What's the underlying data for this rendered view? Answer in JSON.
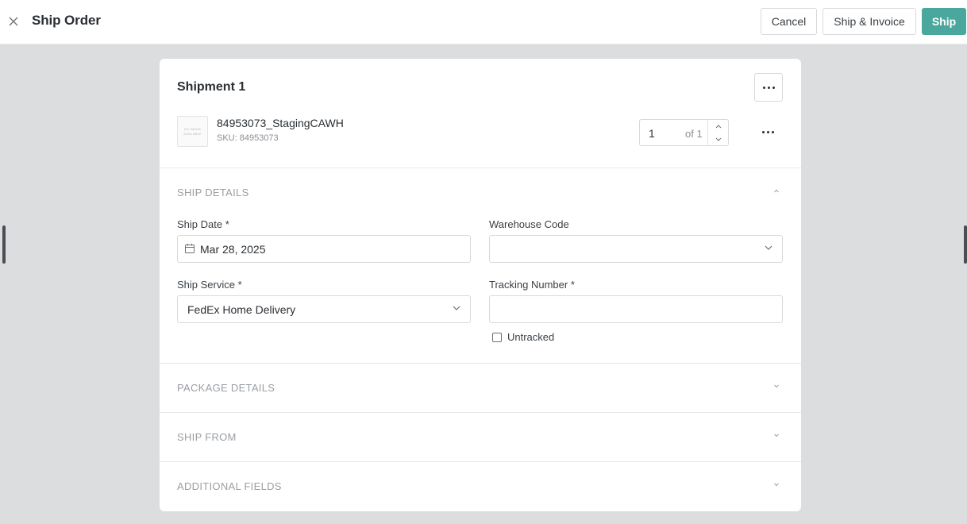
{
  "header": {
    "title": "Ship Order",
    "cancel_label": "Cancel",
    "ship_invoice_label": "Ship & Invoice",
    "ship_label": "Ship"
  },
  "colors": {
    "primary": "#4aa79e",
    "page_bg": "#dcdddf",
    "muted_text": "#9a9ea3"
  },
  "shipment": {
    "title": "Shipment 1",
    "product": {
      "thumbnail_text_1": "NO IMAGE",
      "thumbnail_text_2": "AVAILABLE",
      "name": "84953073_StagingCAWH",
      "sku": "SKU: 84953073"
    },
    "quantity": {
      "value": "1",
      "of_label": "of 1"
    }
  },
  "sections": {
    "ship_details": {
      "label": "SHIP DETAILS",
      "expanded": true,
      "ship_date_label": "Ship Date *",
      "ship_date_value": "Mar 28, 2025",
      "warehouse_code_label": "Warehouse Code",
      "warehouse_code_value": "",
      "ship_service_label": "Ship Service *",
      "ship_service_value": "FedEx Home Delivery",
      "tracking_number_label": "Tracking Number *",
      "tracking_number_value": "",
      "untracked_label": "Untracked",
      "untracked_checked": false
    },
    "package_details": {
      "label": "PACKAGE DETAILS",
      "expanded": false
    },
    "ship_from": {
      "label": "SHIP FROM",
      "expanded": false
    },
    "additional_fields": {
      "label": "ADDITIONAL FIELDS",
      "expanded": false
    }
  },
  "icons": {
    "close": "close-icon",
    "more": "more-horizontal-icon",
    "calendar": "calendar-icon",
    "chevron_down": "chevron-down-icon",
    "chevron_up": "chevron-up-icon"
  }
}
